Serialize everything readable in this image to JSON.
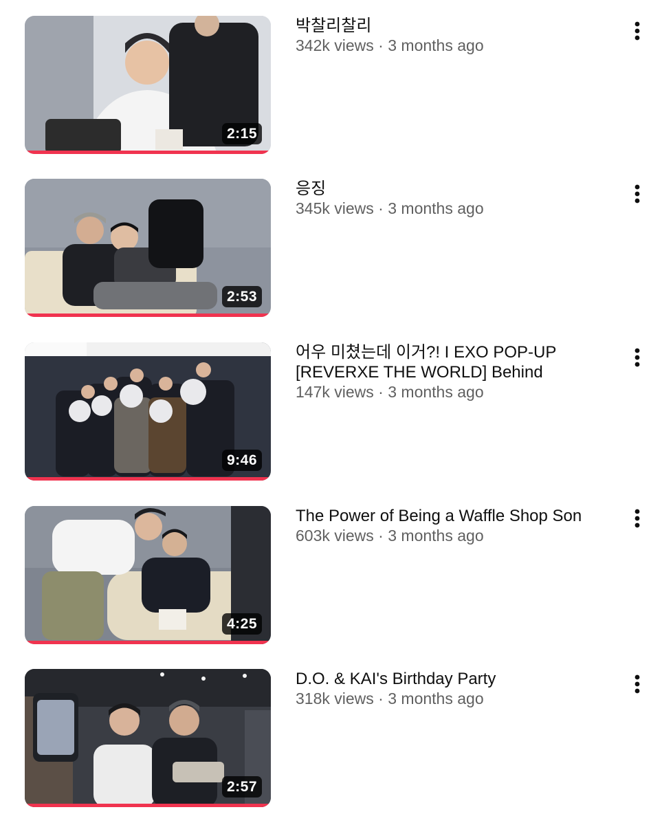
{
  "videos": [
    {
      "title": "박찰리찰리",
      "views": "342k views",
      "separator": "·",
      "age": "3 months ago",
      "duration": "2:15",
      "watched_fraction": 1.0,
      "thumbnail_icon": "video-thumbnail-icon"
    },
    {
      "title": "응징",
      "views": "345k views",
      "separator": "·",
      "age": "3 months ago",
      "duration": "2:53",
      "watched_fraction": 1.0,
      "thumbnail_icon": "video-thumbnail-icon"
    },
    {
      "title": "어우 미쳤는데 이거?! I EXO POP-UP [REVERXE THE WORLD] Behind",
      "views": "147k views",
      "separator": "·",
      "age": "3 months ago",
      "duration": "9:46",
      "watched_fraction": 1.0,
      "thumbnail_icon": "video-thumbnail-icon"
    },
    {
      "title": "The Power of Being a Waffle Shop Son",
      "views": "603k views",
      "separator": "·",
      "age": "3 months ago",
      "duration": "4:25",
      "watched_fraction": 1.0,
      "thumbnail_icon": "video-thumbnail-icon"
    },
    {
      "title": "D.O. & KAI's Birthday Party",
      "views": "318k views",
      "separator": "·",
      "age": "3 months ago",
      "duration": "2:57",
      "watched_fraction": 1.0,
      "thumbnail_icon": "video-thumbnail-icon"
    }
  ],
  "more_icon": "more-vertical-icon",
  "colors": {
    "progress": "#f0334f",
    "title": "#0f0f0f",
    "meta": "#606060",
    "badge_bg": "#000000c7"
  }
}
